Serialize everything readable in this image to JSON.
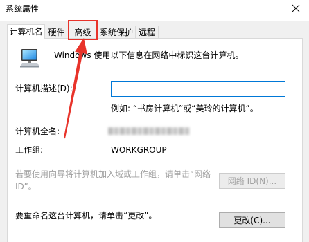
{
  "window": {
    "title": "系统属性",
    "close_icon": "close-icon"
  },
  "tab_strip": {
    "selected_index": 0,
    "tabs": [
      {
        "label": "计算机名"
      },
      {
        "label": "硬件"
      },
      {
        "label": "高级"
      },
      {
        "label": "系统保护"
      },
      {
        "label": "远程"
      }
    ]
  },
  "page": {
    "computer_icon": "computer-icon",
    "intro": "Windows 使用以下信息在网络中标识这台计算机。",
    "description": {
      "label": "计算机描述(D):",
      "value": "",
      "example": "例如: “书房计算机”或“美玲的计算机”。"
    },
    "full_name": {
      "label": "计算机全名:",
      "value_obscured": true
    },
    "workgroup": {
      "label": "工作组:",
      "value": "WORKGROUP"
    },
    "network_id": {
      "text_lines": [
        "若要使用向导将计算机加入域或工作组，请单击“网络",
        "ID”。"
      ],
      "button_label": "网络 ID(N)...",
      "button_enabled": false
    },
    "rename": {
      "text": "要重命名这台计算机，请单击“更改”。",
      "button_label": "更改(C)..."
    }
  },
  "annotation": {
    "highlighted_tab_index": 2,
    "arrow_icon": "arrow-up-icon"
  },
  "colors": {
    "accent": "#0078d7",
    "annotation": "#e8332a",
    "disabled_text": "#a0a0a0",
    "panel_border": "#d9d9d9"
  }
}
